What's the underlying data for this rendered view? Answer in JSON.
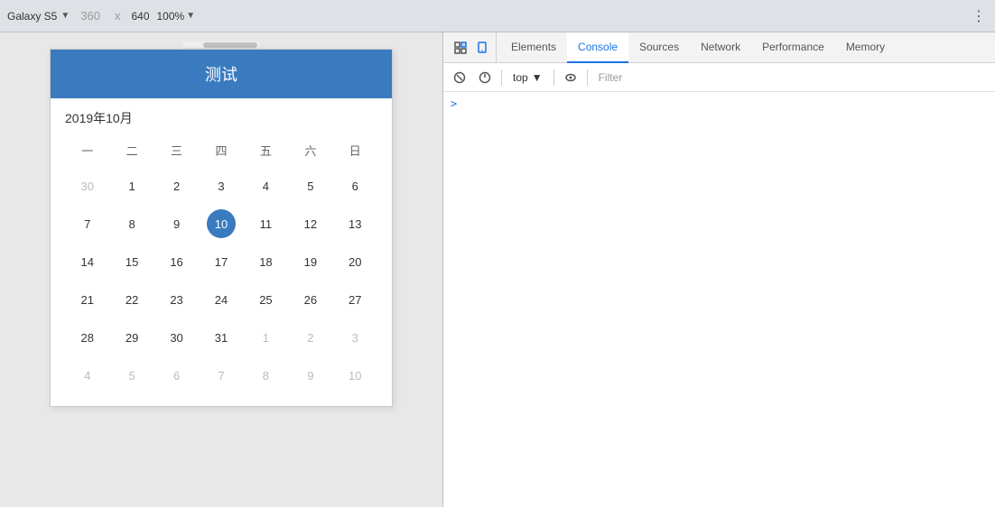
{
  "topbar": {
    "device": "Galaxy S5",
    "width": "360",
    "height": "640",
    "zoom": "100%",
    "more_icon": "⋮"
  },
  "devtools": {
    "tabs": [
      {
        "id": "elements",
        "label": "Elements",
        "active": false
      },
      {
        "id": "console",
        "label": "Console",
        "active": true
      },
      {
        "id": "sources",
        "label": "Sources",
        "active": false
      },
      {
        "id": "network",
        "label": "Network",
        "active": false
      },
      {
        "id": "performance",
        "label": "Performance",
        "active": false
      },
      {
        "id": "memory",
        "label": "Memory",
        "active": false
      }
    ],
    "toolbar": {
      "context_selector": "top",
      "filter_placeholder": "Filter"
    },
    "console_prompt": ">"
  },
  "calendar": {
    "title": "测试",
    "month_label": "2019年10月",
    "weekdays": [
      "一",
      "二",
      "三",
      "四",
      "五",
      "六",
      "日"
    ],
    "weeks": [
      [
        {
          "day": "30",
          "type": "other"
        },
        {
          "day": "1",
          "type": "normal"
        },
        {
          "day": "2",
          "type": "normal"
        },
        {
          "day": "3",
          "type": "normal"
        },
        {
          "day": "4",
          "type": "normal"
        },
        {
          "day": "5",
          "type": "normal"
        },
        {
          "day": "6",
          "type": "normal"
        }
      ],
      [
        {
          "day": "7",
          "type": "normal"
        },
        {
          "day": "8",
          "type": "normal"
        },
        {
          "day": "9",
          "type": "normal"
        },
        {
          "day": "10",
          "type": "selected"
        },
        {
          "day": "11",
          "type": "normal"
        },
        {
          "day": "12",
          "type": "normal"
        },
        {
          "day": "13",
          "type": "normal"
        }
      ],
      [
        {
          "day": "14",
          "type": "normal"
        },
        {
          "day": "15",
          "type": "normal"
        },
        {
          "day": "16",
          "type": "normal"
        },
        {
          "day": "17",
          "type": "normal"
        },
        {
          "day": "18",
          "type": "normal"
        },
        {
          "day": "19",
          "type": "normal"
        },
        {
          "day": "20",
          "type": "normal"
        }
      ],
      [
        {
          "day": "21",
          "type": "normal"
        },
        {
          "day": "22",
          "type": "normal"
        },
        {
          "day": "23",
          "type": "normal"
        },
        {
          "day": "24",
          "type": "normal"
        },
        {
          "day": "25",
          "type": "normal"
        },
        {
          "day": "26",
          "type": "normal"
        },
        {
          "day": "27",
          "type": "normal"
        }
      ],
      [
        {
          "day": "28",
          "type": "normal"
        },
        {
          "day": "29",
          "type": "normal"
        },
        {
          "day": "30",
          "type": "normal"
        },
        {
          "day": "31",
          "type": "normal"
        },
        {
          "day": "1",
          "type": "other"
        },
        {
          "day": "2",
          "type": "other"
        },
        {
          "day": "3",
          "type": "other"
        }
      ],
      [
        {
          "day": "4",
          "type": "other"
        },
        {
          "day": "5",
          "type": "other"
        },
        {
          "day": "6",
          "type": "other"
        },
        {
          "day": "7",
          "type": "other"
        },
        {
          "day": "8",
          "type": "other"
        },
        {
          "day": "9",
          "type": "other"
        },
        {
          "day": "10",
          "type": "other"
        }
      ]
    ]
  }
}
